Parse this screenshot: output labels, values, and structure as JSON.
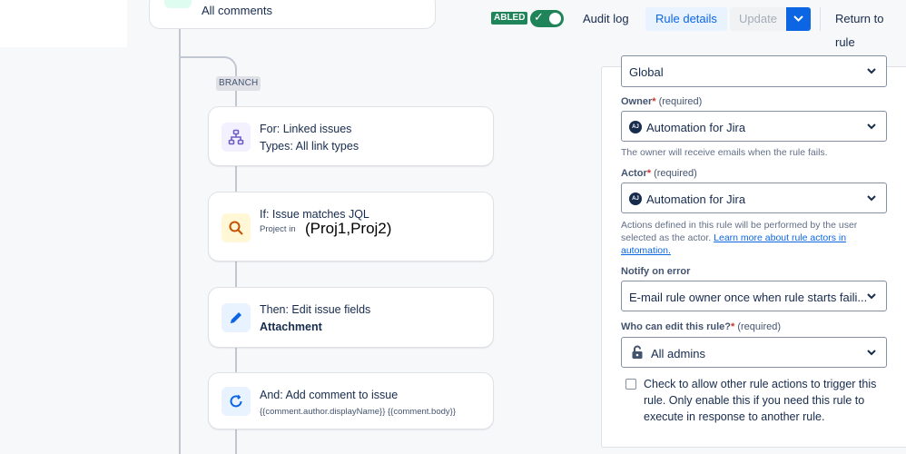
{
  "top_card": {
    "label": "All comments"
  },
  "branch": {
    "tag": "BRANCH"
  },
  "components": [
    {
      "title": "For: Linked issues",
      "subtitle": "Types: All link types",
      "icon": "branch-icon"
    },
    {
      "title": "If: Issue matches JQL",
      "subtitle_prefix": "Project in",
      "subtitle_value": "(Proj1,Proj2)",
      "icon": "search-icon"
    },
    {
      "title": "Then: Edit issue fields",
      "subtitle": "Attachment",
      "icon": "pencil-icon"
    },
    {
      "title": "And: Add comment to issue",
      "subtitle": "{{comment.author.displayName}} {{comment.body}}",
      "icon": "comment-refresh-icon"
    }
  ],
  "header": {
    "enabled_badge": "ABLED",
    "toggle_state": "on",
    "audit_log": "Audit log",
    "rule_details": "Rule details",
    "update": "Update",
    "return": "Return to rule"
  },
  "panel": {
    "scope_value": "Global",
    "owner_label": "Owner",
    "owner_required": "(required)",
    "owner_value": "Automation for Jira",
    "owner_help": "The owner will receive emails when the rule fails.",
    "actor_label": "Actor",
    "actor_required": "(required)",
    "actor_value": "Automation for Jira",
    "actor_help": "Actions defined in this rule will be performed by the user selected as the actor.",
    "actor_help_link": "Learn more about rule actors in automation.",
    "avatar_initials": "AJ",
    "notify_label": "Notify on error",
    "notify_value": "E-mail rule owner once when rule starts faili...",
    "edit_label": "Who can edit this rule?",
    "edit_required": "(required)",
    "edit_value": "All admins",
    "allow_trigger_text": "Check to allow other rule actions to trigger this rule. Only enable this if you need this rule to execute in response to another rule."
  },
  "colors": {
    "accent": "#0c66e4",
    "enabled": "#1f845a",
    "required": "#c9372c"
  }
}
